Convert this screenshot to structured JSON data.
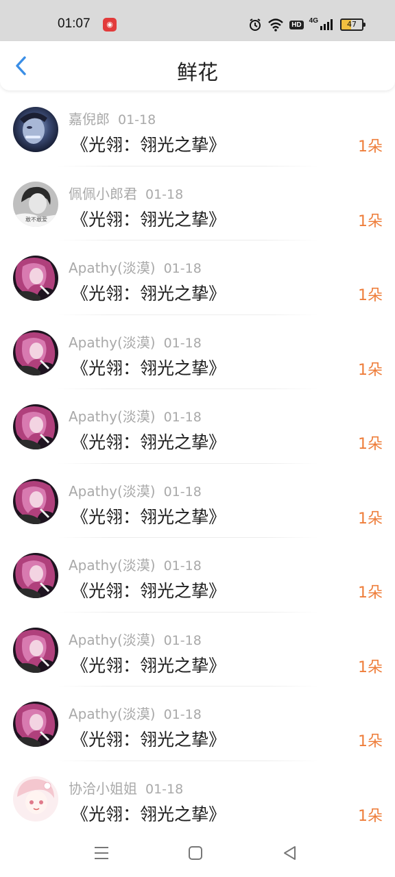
{
  "status_bar": {
    "time": "01:07",
    "app_icon": "red-app-icon",
    "hd": "HD",
    "network": "4G",
    "battery": "47"
  },
  "header": {
    "title": "鲜花",
    "back_icon": "chevron-left-icon",
    "accent_color": "#3a8ee6"
  },
  "records": [
    {
      "user": "嘉倪郎",
      "date": "01-18",
      "work": "《光翎：翎光之挚》",
      "amount": "1朵",
      "avatar": "dark-portrait"
    },
    {
      "user": "佩佩小郎君",
      "date": "01-18",
      "work": "《光翎：翎光之挚》",
      "amount": "1朵",
      "avatar": "grey-portrait",
      "avatar_text": "敢不敢爱"
    },
    {
      "user": "Apathy(淡漠)",
      "date": "01-18",
      "work": "《光翎：翎光之挚》",
      "amount": "1朵",
      "avatar": "anime-pink"
    },
    {
      "user": "Apathy(淡漠)",
      "date": "01-18",
      "work": "《光翎：翎光之挚》",
      "amount": "1朵",
      "avatar": "anime-pink"
    },
    {
      "user": "Apathy(淡漠)",
      "date": "01-18",
      "work": "《光翎：翎光之挚》",
      "amount": "1朵",
      "avatar": "anime-pink"
    },
    {
      "user": "Apathy(淡漠)",
      "date": "01-18",
      "work": "《光翎：翎光之挚》",
      "amount": "1朵",
      "avatar": "anime-pink"
    },
    {
      "user": "Apathy(淡漠)",
      "date": "01-18",
      "work": "《光翎：翎光之挚》",
      "amount": "1朵",
      "avatar": "anime-pink"
    },
    {
      "user": "Apathy(淡漠)",
      "date": "01-18",
      "work": "《光翎：翎光之挚》",
      "amount": "1朵",
      "avatar": "anime-pink"
    },
    {
      "user": "Apathy(淡漠)",
      "date": "01-18",
      "work": "《光翎：翎光之挚》",
      "amount": "1朵",
      "avatar": "anime-pink"
    },
    {
      "user": "协洽小姐姐",
      "date": "01-18",
      "work": "《光翎：翎光之挚》",
      "amount": "1朵",
      "avatar": "anime-light"
    }
  ],
  "colors": {
    "amount": "#ee7d3a",
    "meta": "#a9a9a9",
    "status_bar": "#dadada"
  },
  "nav_bar": {
    "menu_icon": "menu-icon",
    "home_icon": "square-home-icon",
    "back_icon": "triangle-back-icon"
  }
}
